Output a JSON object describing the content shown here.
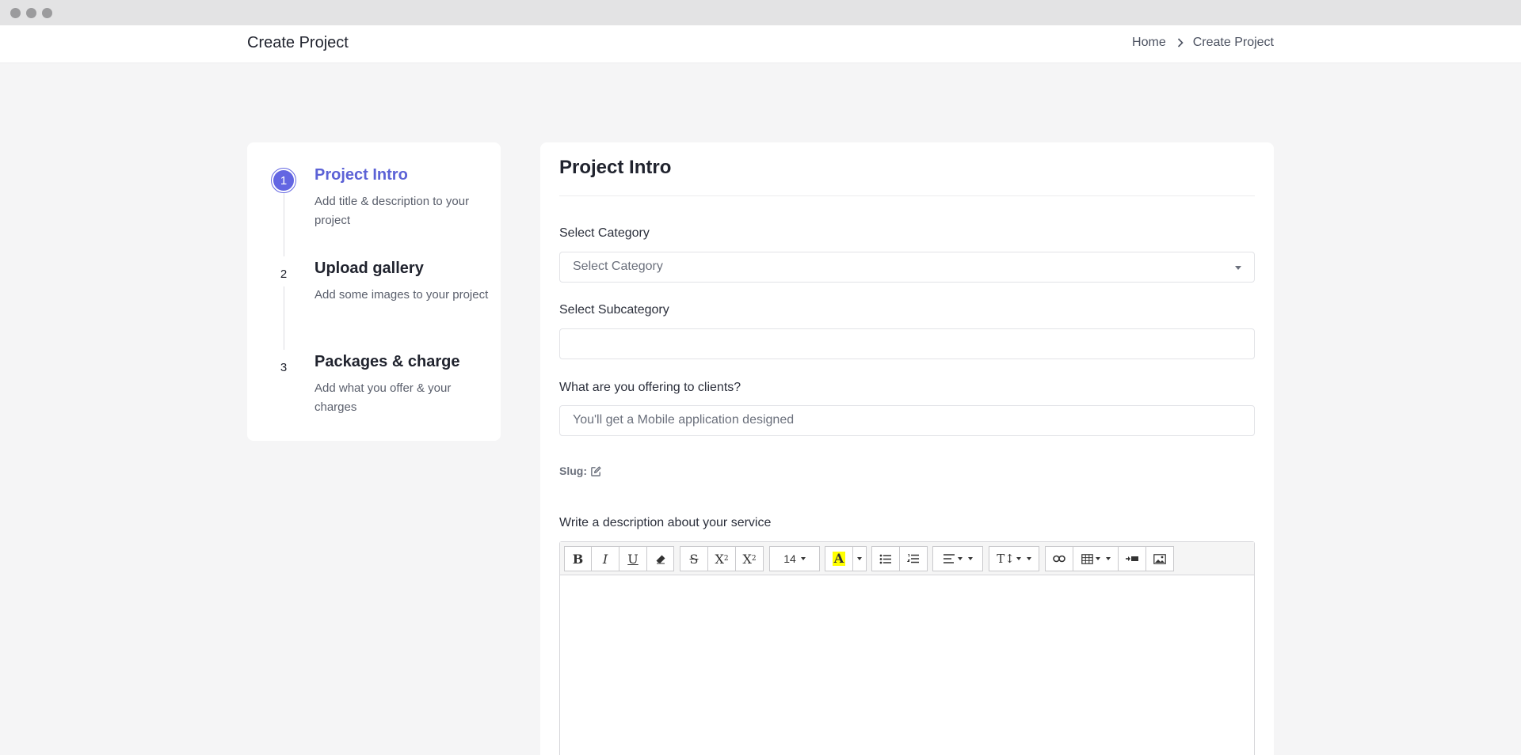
{
  "header": {
    "title": "Create Project",
    "breadcrumb": [
      "Home",
      "Create Project"
    ]
  },
  "steps": [
    {
      "number": "1",
      "title": "Project Intro",
      "desc": "Add title & description to your project",
      "active": true
    },
    {
      "number": "2",
      "title": "Upload gallery",
      "desc": "Add some images to your project",
      "active": false
    },
    {
      "number": "3",
      "title": "Packages & charge",
      "desc": "Add what you offer & your charges",
      "active": false
    }
  ],
  "form": {
    "section_title": "Project Intro",
    "category": {
      "label": "Select Category",
      "selected": "Select Category"
    },
    "subcategory": {
      "label": "Select Subcategory",
      "value": ""
    },
    "offering": {
      "label": "What are you offering to clients?",
      "placeholder": "You'll get a Mobile application designed"
    },
    "slug_label": "Slug:",
    "description_label": "Write a description about your service"
  },
  "editor": {
    "font_size": "14",
    "tools": [
      "bold",
      "italic",
      "underline",
      "clear-format",
      "strikethrough",
      "superscript",
      "subscript",
      "font-size",
      "highlight-color",
      "bullet-list",
      "numbered-list",
      "paragraph-align",
      "line-height",
      "link",
      "table",
      "horizontal-rule",
      "image"
    ]
  },
  "colors": {
    "accent": "#6366e2",
    "background": "#f5f5f6",
    "text": "#20232e"
  }
}
